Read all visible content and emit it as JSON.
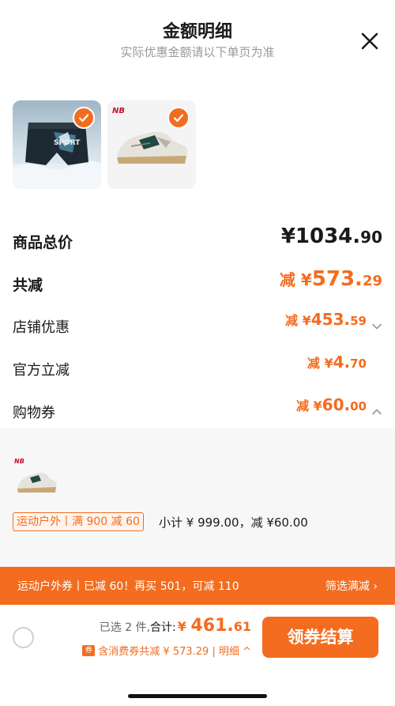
{
  "header": {
    "title": "金额明细",
    "subtitle": "实际优惠金额请以下单页为准"
  },
  "items": [
    {
      "name": "swim-trunks",
      "selected": true
    },
    {
      "name": "new-balance-sneaker",
      "selected": true
    }
  ],
  "summary": {
    "total_label": "商品总价",
    "total_currency": "¥",
    "total_int": "1034.",
    "total_dec": "90",
    "savings_label": "共减",
    "savings_prefix": "减 ¥",
    "savings_int": "573.",
    "savings_dec": "29"
  },
  "discounts": [
    {
      "label": "店铺优惠",
      "prefix": "减 ¥",
      "int": "453.",
      "dec": "59",
      "chevron": "chevron-down-icon"
    },
    {
      "label": "官方立减",
      "prefix": "减 ¥",
      "int": "4.",
      "dec": "70"
    },
    {
      "label": "购物券",
      "prefix": "减 ¥",
      "int": "60.",
      "dec": "00",
      "chevron": "chevron-up-icon"
    }
  ],
  "coupon_detail": {
    "tag": "运动户外丨满 900 减 60",
    "subtotal": "小计 ¥ 999.00，减 ¥60.00"
  },
  "promo": {
    "text": "运动户外券丨已减 60！再买 501，可减 110",
    "link": "筛选满减 ›"
  },
  "footer": {
    "selected": "已选 2 件,",
    "total_label": "合计:",
    "amount_prefix": "¥ ",
    "amount_int": "461.",
    "amount_dec": "61",
    "coupon_badge": "券",
    "detail": "含消费券共减 ¥ 573.29 | 明细 ^",
    "checkout": "领券结算"
  },
  "colors": {
    "accent": "#f36c1f",
    "text": "#1a1a1a",
    "muted": "#999999"
  }
}
